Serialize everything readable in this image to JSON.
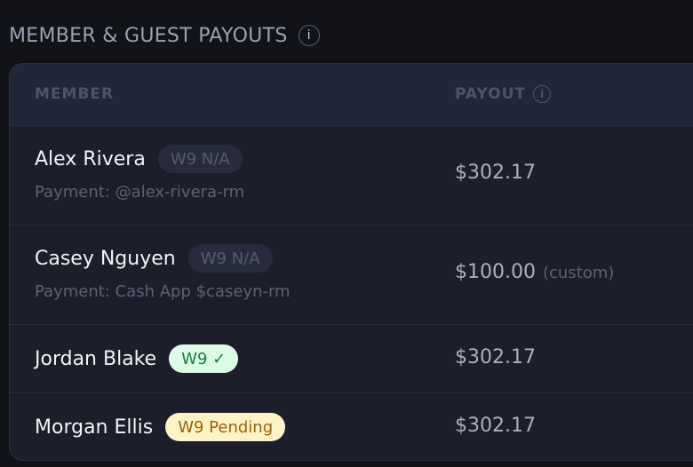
{
  "section": {
    "title": "MEMBER & GUEST PAYOUTS",
    "info_glyph": "i"
  },
  "table": {
    "columns": {
      "member": "MEMBER",
      "payout": "PAYOUT",
      "payout_info_glyph": "i"
    },
    "rows": [
      {
        "name": "Alex Rivera",
        "w9_badge": "W9 N/A",
        "w9_status": "n/a",
        "payment": "Payment: @alex-rivera-rm",
        "amount": "$302.17",
        "note": ""
      },
      {
        "name": "Casey Nguyen",
        "w9_badge": "W9 N/A",
        "w9_status": "n/a",
        "payment": "Payment: Cash App $caseyn-rm",
        "amount": "$100.00",
        "note": "(custom)"
      },
      {
        "name": "Jordan Blake",
        "w9_badge": "W9 ✓",
        "w9_status": "complete",
        "payment": "",
        "amount": "$302.17",
        "note": ""
      },
      {
        "name": "Morgan Ellis",
        "w9_badge": "W9 Pending",
        "w9_status": "pending",
        "payment": "",
        "amount": "$302.17",
        "note": ""
      }
    ]
  },
  "colors": {
    "background": "#121318",
    "card": "#1c1f2a",
    "header_band": "#22263a",
    "badge_na_bg": "#272b3c",
    "badge_ok_bg": "#dcfce7",
    "badge_ok_text": "#15803d",
    "badge_pending_bg": "#fef3c7",
    "badge_pending_text": "#a16207"
  }
}
